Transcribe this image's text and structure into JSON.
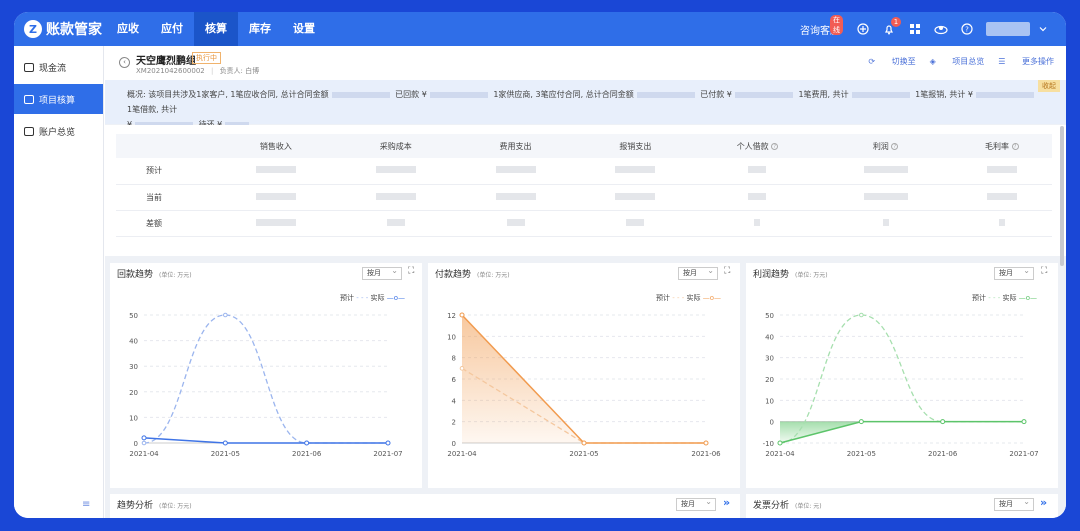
{
  "app": {
    "logo_letter": "Z",
    "name": "账款管家"
  },
  "nav": [
    {
      "label": "应收",
      "active": false
    },
    {
      "label": "应付",
      "active": false
    },
    {
      "label": "核算",
      "active": true
    },
    {
      "label": "库存",
      "active": false
    },
    {
      "label": "设置",
      "active": false
    }
  ],
  "topright": {
    "service": "咨询客服",
    "online_badge": "在线",
    "bell_count": "1"
  },
  "sidebar": [
    {
      "label": "现金流",
      "active": false
    },
    {
      "label": "项目核算",
      "active": true
    },
    {
      "label": "账户总览",
      "active": false
    }
  ],
  "collapse_icon": "≡",
  "project": {
    "title": "天空鹰烈鹏组",
    "status": "执行中",
    "code": "XM2021042600002",
    "owner_label": "负责人:",
    "owner": "白博"
  },
  "actions": [
    "切换至",
    "项目总览",
    "更多操作"
  ],
  "summary": {
    "label": "概况:",
    "t1": "该项目共涉及1家客户, 1笔应收合同, 总计合同金额",
    "t2": "已回款 ¥",
    "t3": "1家供应商, 3笔应付合同, 总计合同金额",
    "t4": "已付款 ¥",
    "t5": "1笔费用, 共计",
    "t6": "1笔报销, 共计 ¥",
    "t7": "1笔借款, 共计",
    "t8": "¥",
    "t9": "待还 ¥",
    "collapse": "收起"
  },
  "table": {
    "headers": [
      "",
      "销售收入",
      "采购成本",
      "费用支出",
      "报销支出",
      "个人借款",
      "利润",
      "毛利率"
    ],
    "rows": [
      "预计",
      "当前",
      "差额"
    ]
  },
  "cards": {
    "c1": {
      "title": "回款趋势",
      "unit": "(单位: 万元)",
      "select": "按月"
    },
    "c2": {
      "title": "付款趋势",
      "unit": "(单位: 万元)",
      "select": "按月"
    },
    "c3": {
      "title": "利润趋势",
      "unit": "(单位: 万元)",
      "select": "按月"
    },
    "c4": {
      "title": "趋势分析",
      "unit": "(单位: 万元)",
      "select": "按月",
      "arrows": "»"
    },
    "c5": {
      "title": "发票分析",
      "unit": "(单位: 元)",
      "select": "按月",
      "arrows": "»"
    }
  },
  "legend": {
    "plan": "预计",
    "actual": "实际"
  },
  "colors": {
    "brand": "#2f6ee8",
    "blue_series": "#3f74e6",
    "orange_series": "#f19b4f",
    "green_series": "#5cc46a"
  },
  "chart_data": [
    {
      "type": "line",
      "title": "回款趋势",
      "x": [
        "2021-04",
        "2021-05",
        "2021-06",
        "2021-07"
      ],
      "series": [
        {
          "name": "预计",
          "values": [
            0,
            50,
            0,
            0
          ]
        },
        {
          "name": "实际",
          "values": [
            2,
            0,
            0,
            0
          ]
        }
      ],
      "yticks": [
        0,
        10,
        20,
        30,
        40,
        50
      ],
      "ylim": [
        0,
        50
      ]
    },
    {
      "type": "area",
      "title": "付款趋势",
      "x": [
        "2021-04",
        "2021-05",
        "2021-06"
      ],
      "series": [
        {
          "name": "预计",
          "values": [
            7,
            0,
            0
          ]
        },
        {
          "name": "实际",
          "values": [
            12,
            0,
            0
          ]
        }
      ],
      "yticks": [
        0,
        2,
        4,
        6,
        8,
        10,
        12
      ],
      "ylim": [
        0,
        12
      ]
    },
    {
      "type": "area",
      "title": "利润趋势",
      "x": [
        "2021-04",
        "2021-05",
        "2021-06",
        "2021-07"
      ],
      "series": [
        {
          "name": "预计",
          "values": [
            -10,
            50,
            0,
            0
          ]
        },
        {
          "name": "实际",
          "values": [
            -10,
            0,
            0,
            0
          ]
        }
      ],
      "yticks": [
        -10,
        0,
        10,
        20,
        30,
        40,
        50
      ],
      "ylim": [
        -10,
        50
      ]
    }
  ]
}
